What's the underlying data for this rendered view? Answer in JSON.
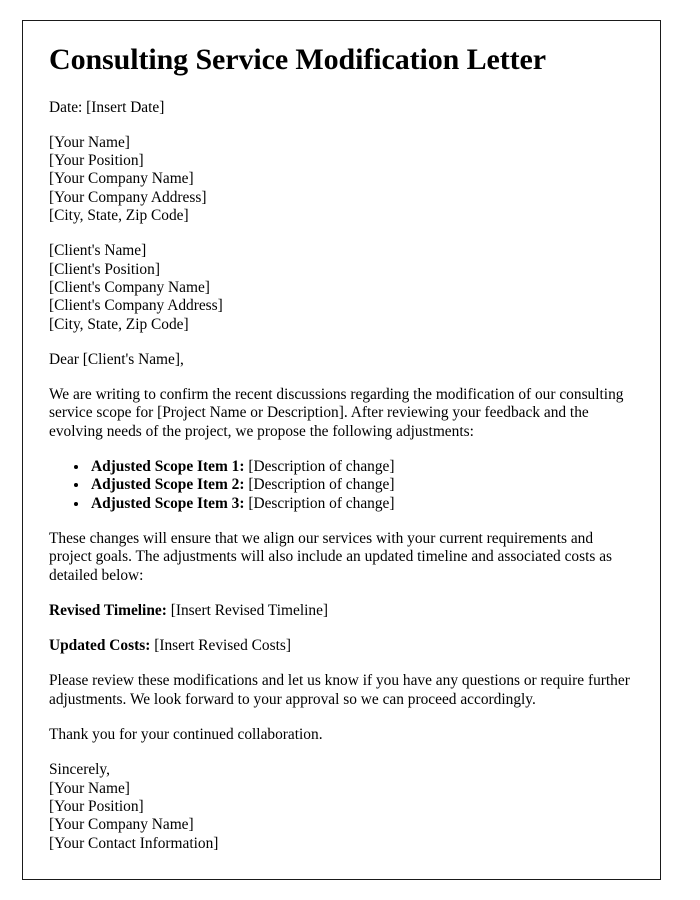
{
  "document": {
    "title": "Consulting Service Modification Letter",
    "date_line": "Date: [Insert Date]",
    "sender_block": [
      "[Your Name]",
      "[Your Position]",
      "[Your Company Name]",
      "[Your Company Address]",
      "[City, State, Zip Code]"
    ],
    "recipient_block": [
      "[Client's Name]",
      "[Client's Position]",
      "[Client's Company Name]",
      "[Client's Company Address]",
      "[City, State, Zip Code]"
    ],
    "salutation": "Dear [Client's Name],",
    "intro_paragraph": "We are writing to confirm the recent discussions regarding the modification of our consulting service scope for [Project Name or Description]. After reviewing your feedback and the evolving needs of the project, we propose the following adjustments:",
    "scope_items": [
      {
        "label": "Adjusted Scope Item 1:",
        "value": "[Description of change]"
      },
      {
        "label": "Adjusted Scope Item 2:",
        "value": "[Description of change]"
      },
      {
        "label": "Adjusted Scope Item 3:",
        "value": "[Description of change]"
      }
    ],
    "changes_paragraph": "These changes will ensure that we align our services with your current requirements and project goals. The adjustments will also include an updated timeline and associated costs as detailed below:",
    "timeline": {
      "label": "Revised Timeline:",
      "value": "[Insert Revised Timeline]"
    },
    "costs": {
      "label": "Updated Costs:",
      "value": "[Insert Revised Costs]"
    },
    "review_paragraph": "Please review these modifications and let us know if you have any questions or require further adjustments. We look forward to your approval so we can proceed accordingly.",
    "thanks_paragraph": "Thank you for your continued collaboration.",
    "closing_block": [
      "Sincerely,",
      "[Your Name]",
      "[Your Position]",
      "[Your Company Name]",
      "[Your Contact Information]"
    ]
  }
}
